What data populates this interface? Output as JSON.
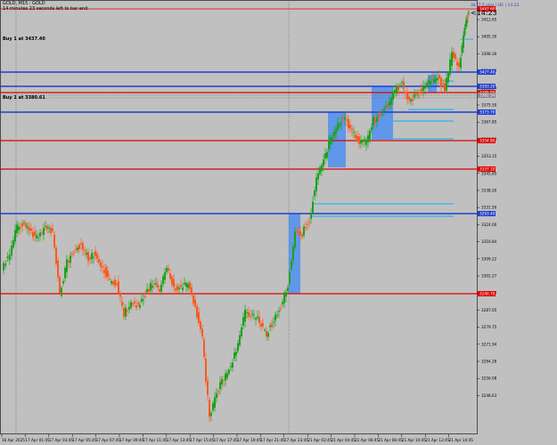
{
  "header": {
    "symbol_line": "GOLD, M15 : GOLD",
    "timer_line": "14 minutes 23 seconds left to bar end"
  },
  "position_labels": [
    {
      "text": "Buy 1 at 3437.40"
    },
    {
      "text": "Buy 1 at 3380.61"
    }
  ],
  "countdown": {
    "label": "<14:23",
    "sub_label": "3437.5 pips | HE | 14:23"
  },
  "price_scale": {
    "labels": [
      "3412.65",
      "3405.30",
      "3398.30",
      "3390.80",
      "3382.54",
      "3375.50",
      "3367.85",
      "3360.50",
      "3353.15",
      "3345.85",
      "3338.20",
      "3331.50",
      "3324.00",
      "3316.84",
      "3309.22",
      "3302.27",
      "3294.68",
      "3287.05",
      "3279.75",
      "3271.94",
      "3264.28",
      "3256.08",
      "3248.63"
    ]
  },
  "price_tags": [
    {
      "text": "3447.60",
      "color": "#e00000"
    },
    {
      "text": "3427.40",
      "color": "#1e3fd0"
    },
    {
      "text": "3393.20",
      "color": "#1e3fd0"
    },
    {
      "text": "3385.90",
      "color": "#e00000"
    },
    {
      "text": "3382.54",
      "color": "#888888"
    },
    {
      "text": "3373.70",
      "color": "#1e3fd0"
    },
    {
      "text": "3354.80",
      "color": "#e00000"
    },
    {
      "text": "3337.10",
      "color": "#e00000"
    },
    {
      "text": "3293.40",
      "color": "#1e3fd0"
    },
    {
      "text": "3240.70",
      "color": "#e00000"
    }
  ],
  "time_axis": {
    "labels": [
      "16 Apr 2025",
      "17 Apr 01:45",
      "17 Apr 03:45",
      "17 Apr 05:45",
      "17 Apr 07:45",
      "17 Apr 09:45",
      "17 Apr 11:45",
      "17 Apr 13:45",
      "17 Apr 15:45",
      "17 Apr 17:45",
      "17 Apr 19:45",
      "17 Apr 21:45",
      "17 Apr 23:45",
      "21 Apr 02:45",
      "21 Apr 04:45",
      "21 Apr 06:45",
      "21 Apr 08:45",
      "21 Apr 10:45",
      "21 Apr 12:45",
      "21 Apr 14:45"
    ]
  },
  "colors": {
    "background": "#c0c0c0",
    "bull_candle": "#1aa31a",
    "bear_candle": "#ff5a1e",
    "resistance_line": "#e00000",
    "support_line": "#1e3fd0",
    "zone_fill": "#4f8ff0",
    "cyan_line": "#29b6e8"
  }
}
